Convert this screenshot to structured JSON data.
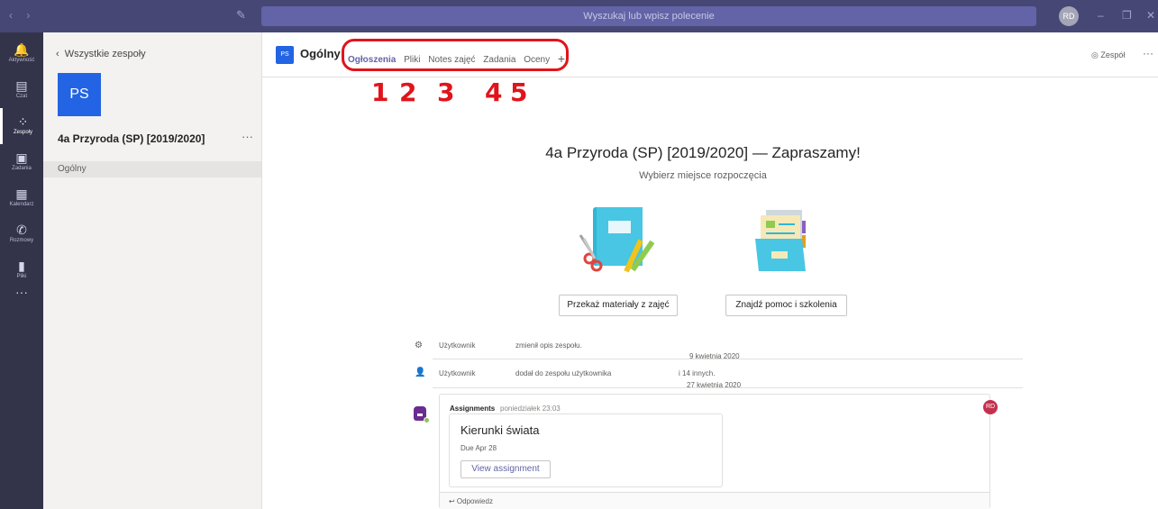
{
  "topbar": {
    "nav_arrows": "‹ ›",
    "compose_icon": "compose-icon",
    "search_placeholder": "Wyszukaj lub wpisz polecenie",
    "avatar_initials": "RD",
    "minimize": "–",
    "restore": "❐",
    "close": "✕"
  },
  "rail": {
    "items": [
      {
        "label": "Aktywność",
        "icon": "bell-icon",
        "glyph": "🔔"
      },
      {
        "label": "Czat",
        "icon": "chat-icon",
        "glyph": "▤"
      },
      {
        "label": "Zespoły",
        "icon": "teams-icon",
        "glyph": "⁘"
      },
      {
        "label": "Zadania",
        "icon": "assignments-icon",
        "glyph": "▣"
      },
      {
        "label": "Kalendarz",
        "icon": "calendar-icon",
        "glyph": "▦"
      },
      {
        "label": "Rozmowy",
        "icon": "phone-icon",
        "glyph": "✆"
      },
      {
        "label": "Pliki",
        "icon": "files-icon",
        "glyph": "▮"
      }
    ],
    "more": "···"
  },
  "panel": {
    "back_label": "Wszystkie zespoły",
    "team_tile": "PS",
    "team_name": "4a Przyroda (SP) [2019/2020]",
    "more": "···",
    "channel": "Ogólny"
  },
  "header": {
    "channel_icon": "PS",
    "channel_title": "Ogólny",
    "tabs": [
      "Ogłoszenia",
      "Pliki",
      "Notes zajęć",
      "Zadania",
      "Oceny"
    ],
    "add_tab": "+",
    "team_button": "◎ Zespół",
    "more": "···"
  },
  "annotations": [
    "1",
    "2",
    "3",
    "4",
    "5"
  ],
  "welcome": {
    "title": "4a Przyroda (SP) [2019/2020] — Zapraszamy!",
    "subtitle": "Wybierz miejsce rozpoczęcia",
    "button_materials": "Przekaż materiały z zajęć",
    "button_help": "Znajdź pomoc i szkolenia"
  },
  "activity": [
    {
      "icon": "team-settings-icon",
      "user": "Użytkownik",
      "action": "zmienił opis zespołu.",
      "extra": "",
      "date": "9 kwietnia 2020"
    },
    {
      "icon": "add-user-icon",
      "user": "Użytkownik",
      "action": "dodał do zespołu użytkownika",
      "extra": "i 14 innych.",
      "date": "27 kwietnia 2020"
    }
  ],
  "post": {
    "author": "Assignments",
    "time": "poniedziałek 23:03",
    "card_title": "Kierunki świata",
    "due": "Due Apr 28",
    "view_button": "View assignment",
    "reply": "↩ Odpowiedz",
    "reaction": "RD"
  },
  "colors": {
    "accent": "#6264a7",
    "topbar": "#464775",
    "rail": "#33344a",
    "team_tile": "#2264e3",
    "annotation_red": "#e1141b"
  }
}
